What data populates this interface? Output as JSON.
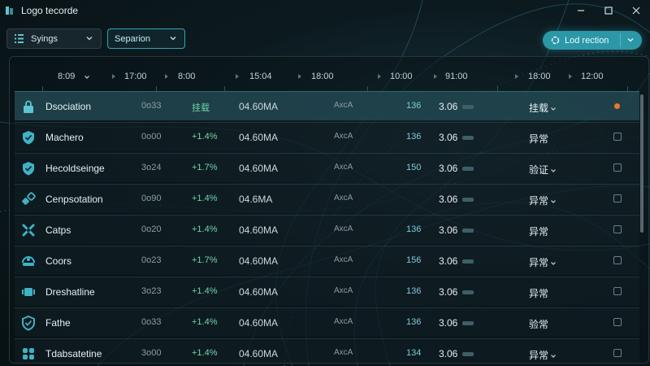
{
  "window": {
    "title": "Logo tecorde"
  },
  "toolbar": {
    "settings_label": "Syings",
    "separator_label": "Separion",
    "primary_label": "Lod rection"
  },
  "header": {
    "columns": [
      "8:09",
      "17:00",
      "8:00",
      "15:04",
      "18:00",
      "10:00",
      "91:00",
      "18:00",
      "12:00"
    ]
  },
  "rows": [
    {
      "icon": "lock-icon",
      "name": "Dsociation",
      "code": "0o33",
      "delta": "挂载",
      "rate": "04.60MA",
      "unit": "AxcA",
      "num": "136",
      "val": "3.06",
      "status": "挂载",
      "status_dropdown": true,
      "flag": "dot",
      "selected": true
    },
    {
      "icon": "shield-icon",
      "name": "Machero",
      "code": "0o00",
      "delta": "+1.4%",
      "rate": "04.60MA",
      "unit": "AxcA",
      "num": "136",
      "val": "3.06",
      "status": "异常",
      "status_dropdown": false,
      "flag": "box",
      "selected": false
    },
    {
      "icon": "shield-icon",
      "name": "Hecoldseinge",
      "code": "3o24",
      "delta": "+1.7%",
      "rate": "04.60MA",
      "unit": "AxcA",
      "num": "150",
      "val": "3.06",
      "status": "验证",
      "status_dropdown": true,
      "flag": "box",
      "selected": false
    },
    {
      "icon": "link-icon",
      "name": "Cenpsotation",
      "code": "0o90",
      "delta": "+1.4%",
      "rate": "04.6MA",
      "unit": "AxcA",
      "num": "",
      "val": "3.06",
      "status": "异常",
      "status_dropdown": true,
      "flag": "box",
      "selected": false
    },
    {
      "icon": "cross-icon",
      "name": "Catps",
      "code": "0o20",
      "delta": "+1.4%",
      "rate": "04.60MA",
      "unit": "AxcA",
      "num": "136",
      "val": "3.06",
      "status": "异常",
      "status_dropdown": false,
      "flag": "box",
      "selected": false
    },
    {
      "icon": "connect-icon",
      "name": "Coors",
      "code": "0o23",
      "delta": "+1.7%",
      "rate": "04.60MA",
      "unit": "AxcA",
      "num": "156",
      "val": "3.06",
      "status": "异常",
      "status_dropdown": true,
      "flag": "box",
      "selected": false
    },
    {
      "icon": "video-icon",
      "name": "Dreshatline",
      "code": "3o23",
      "delta": "+1.4%",
      "rate": "04.60MA",
      "unit": "AxcA",
      "num": "136",
      "val": "3.06",
      "status": "异常",
      "status_dropdown": false,
      "flag": "box",
      "selected": false
    },
    {
      "icon": "check-shield-icon",
      "name": "Fathe",
      "code": "0o33",
      "delta": "+1.4%",
      "rate": "04.60MA",
      "unit": "AxcA",
      "num": "136",
      "val": "3.06",
      "status": "验常",
      "status_dropdown": false,
      "flag": "box",
      "selected": false
    },
    {
      "icon": "users-icon",
      "name": "Tdabsatetine",
      "code": "3o00",
      "delta": "+1.4%",
      "rate": "04.60MA",
      "unit": "AxcA",
      "num": "134",
      "val": "3.06",
      "status": "异常",
      "status_dropdown": true,
      "flag": "box",
      "selected": false
    }
  ],
  "colors": {
    "accent": "#2b97a7",
    "positive": "#6fd5a8",
    "alert": "#e8792c"
  }
}
